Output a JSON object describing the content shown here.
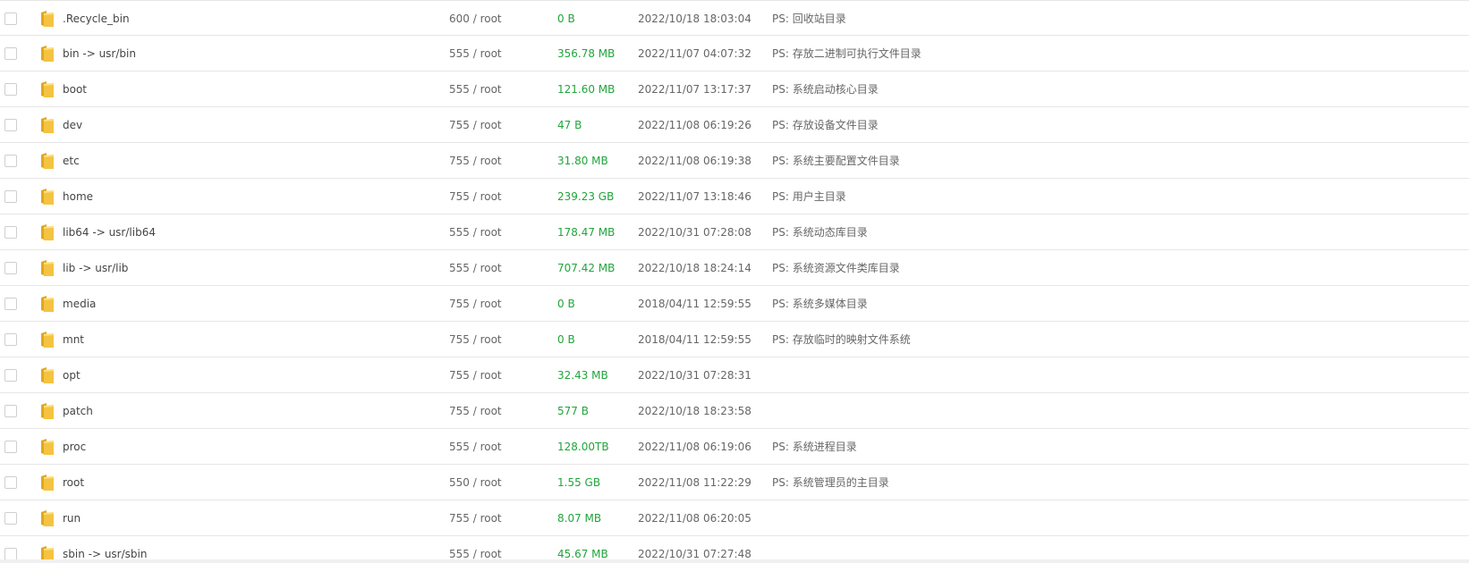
{
  "icon": "folder-icon",
  "colors": {
    "size_text": "#20a53a",
    "folder_front": "#f5c342",
    "folder_back": "#e0a81f",
    "row_border": "#e6e6e6"
  },
  "rows": [
    {
      "name": ".Recycle_bin",
      "perm": "600 / root",
      "size": "0 B",
      "time": "2022/10/18 18:03:04",
      "ps": "PS: 回收站目录"
    },
    {
      "name": "bin -> usr/bin",
      "perm": "555 / root",
      "size": "356.78 MB",
      "time": "2022/11/07 04:07:32",
      "ps": "PS: 存放二进制可执行文件目录"
    },
    {
      "name": "boot",
      "perm": "555 / root",
      "size": "121.60 MB",
      "time": "2022/11/07 13:17:37",
      "ps": "PS: 系统启动核心目录"
    },
    {
      "name": "dev",
      "perm": "755 / root",
      "size": "47 B",
      "time": "2022/11/08 06:19:26",
      "ps": "PS: 存放设备文件目录"
    },
    {
      "name": "etc",
      "perm": "755 / root",
      "size": "31.80 MB",
      "time": "2022/11/08 06:19:38",
      "ps": "PS: 系统主要配置文件目录"
    },
    {
      "name": "home",
      "perm": "755 / root",
      "size": "239.23 GB",
      "time": "2022/11/07 13:18:46",
      "ps": "PS: 用户主目录"
    },
    {
      "name": "lib64 -> usr/lib64",
      "perm": "555 / root",
      "size": "178.47 MB",
      "time": "2022/10/31 07:28:08",
      "ps": "PS: 系统动态库目录"
    },
    {
      "name": "lib -> usr/lib",
      "perm": "555 / root",
      "size": "707.42 MB",
      "time": "2022/10/18 18:24:14",
      "ps": "PS: 系统资源文件类库目录"
    },
    {
      "name": "media",
      "perm": "755 / root",
      "size": "0 B",
      "time": "2018/04/11 12:59:55",
      "ps": "PS: 系统多媒体目录"
    },
    {
      "name": "mnt",
      "perm": "755 / root",
      "size": "0 B",
      "time": "2018/04/11 12:59:55",
      "ps": "PS: 存放临时的映射文件系统"
    },
    {
      "name": "opt",
      "perm": "755 / root",
      "size": "32.43 MB",
      "time": "2022/10/31 07:28:31",
      "ps": ""
    },
    {
      "name": "patch",
      "perm": "755 / root",
      "size": "577 B",
      "time": "2022/10/18 18:23:58",
      "ps": ""
    },
    {
      "name": "proc",
      "perm": "555 / root",
      "size": "128.00TB",
      "time": "2022/11/08 06:19:06",
      "ps": "PS: 系统进程目录"
    },
    {
      "name": "root",
      "perm": "550 / root",
      "size": "1.55 GB",
      "time": "2022/11/08 11:22:29",
      "ps": "PS: 系统管理员的主目录"
    },
    {
      "name": "run",
      "perm": "755 / root",
      "size": "8.07 MB",
      "time": "2022/11/08 06:20:05",
      "ps": ""
    },
    {
      "name": "sbin -> usr/sbin",
      "perm": "555 / root",
      "size": "45.67 MB",
      "time": "2022/10/31 07:27:48",
      "ps": ""
    }
  ]
}
